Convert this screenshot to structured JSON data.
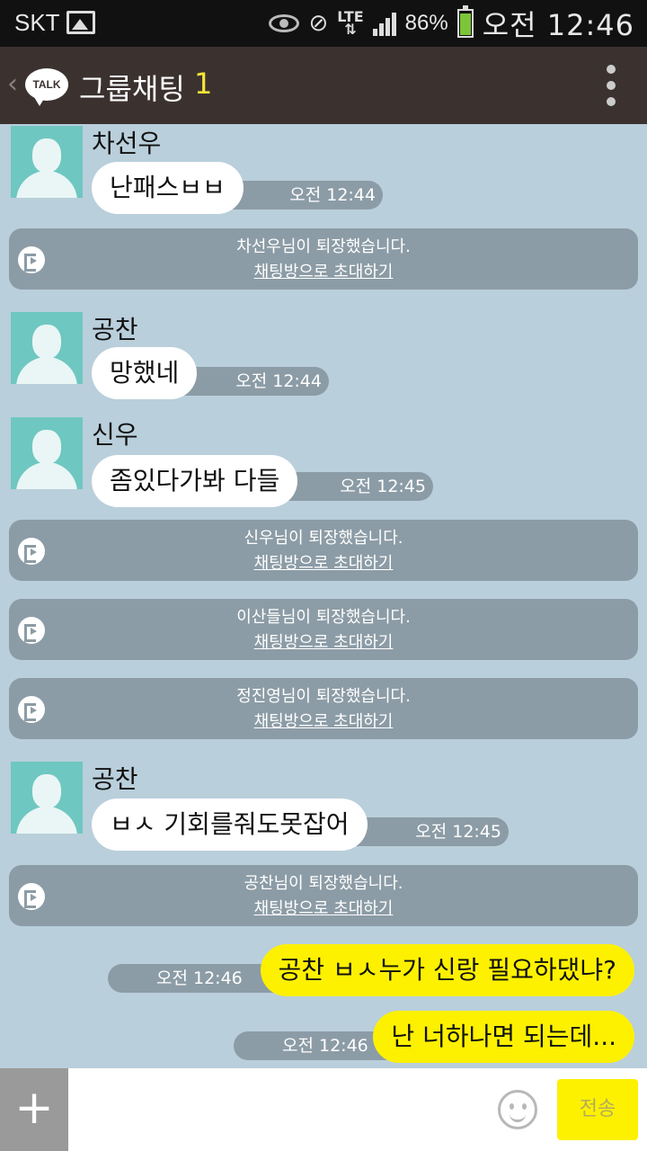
{
  "status_bar": {
    "carrier": "SKT",
    "network": "LTE",
    "battery": "86%",
    "time": "오전 12:46"
  },
  "title_bar": {
    "logo": "TALK",
    "title": "그룹채팅",
    "member_count": "1"
  },
  "messages": [
    {
      "type": "received",
      "sender": "차선우",
      "text": "난패스ㅂㅂ",
      "time": "오전 12:44"
    },
    {
      "type": "system",
      "text": "차선우님이 퇴장했습니다.",
      "link": "채팅방으로 초대하기"
    },
    {
      "type": "received",
      "sender": "공찬",
      "text": "망했네",
      "time": "오전 12:44"
    },
    {
      "type": "received",
      "sender": "신우",
      "text": "좀있다가봐 다들",
      "time": "오전 12:45"
    },
    {
      "type": "system",
      "text": "신우님이 퇴장했습니다.",
      "link": "채팅방으로 초대하기"
    },
    {
      "type": "system",
      "text": "이산들님이 퇴장했습니다.",
      "link": "채팅방으로 초대하기"
    },
    {
      "type": "system",
      "text": "정진영님이 퇴장했습니다.",
      "link": "채팅방으로 초대하기"
    },
    {
      "type": "received",
      "sender": "공찬",
      "text": "ㅂㅅ 기회를줘도못잡어",
      "time": "오전 12:45"
    },
    {
      "type": "system",
      "text": "공찬님이 퇴장했습니다.",
      "link": "채팅방으로 초대하기"
    },
    {
      "type": "sent",
      "text": "공찬 ㅂㅅ누가 신랑 필요하댔냐?",
      "time": "오전 12:46"
    },
    {
      "type": "sent",
      "text": "난 너하나면 되는데...",
      "time": "오전 12:46"
    }
  ],
  "input_bar": {
    "plus": "+",
    "placeholder": "",
    "send_label": "전송"
  },
  "colors": {
    "chat_background": "#b9cfdb",
    "title_bar": "#3b3230",
    "sent_bubble": "#fdf100",
    "received_bubble": "#ffffff",
    "system_box": "#8c9ca6",
    "avatar": "#6fc7c1"
  }
}
